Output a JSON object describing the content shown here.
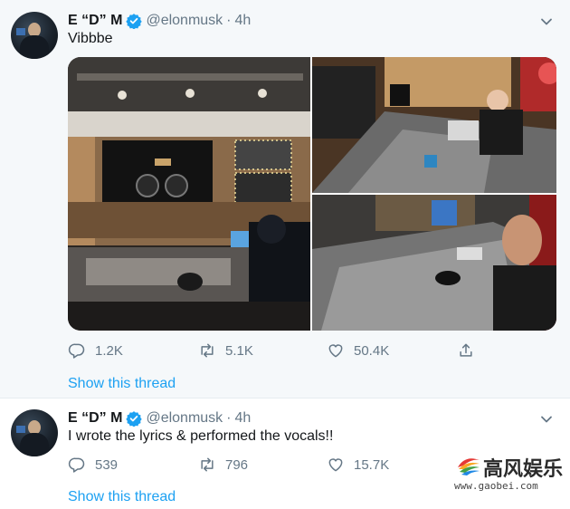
{
  "tweets": [
    {
      "author": {
        "name": "E “D” M",
        "handle": "@elonmusk"
      },
      "time": "4h",
      "text": "Vibbbe",
      "counts": {
        "reply": "1.2K",
        "retweet": "5.1K",
        "like": "50.4K"
      },
      "show_thread": "Show this thread"
    },
    {
      "author": {
        "name": "E “D” M",
        "handle": "@elonmusk"
      },
      "time": "4h",
      "text": "I wrote the lyrics & performed the vocals!!",
      "counts": {
        "reply": "539",
        "retweet": "796",
        "like": "15.7K"
      },
      "show_thread": "Show this thread"
    }
  ],
  "separator": "·",
  "icons": [
    "verified-badge-icon",
    "chevron-down-icon",
    "reply-icon",
    "retweet-icon",
    "like-icon",
    "share-icon"
  ],
  "colors": {
    "accent": "#1da1f2",
    "muted": "#657786",
    "text": "#14171a"
  },
  "watermark": {
    "title": "高风娱乐",
    "url": "www.gaobei.com"
  }
}
